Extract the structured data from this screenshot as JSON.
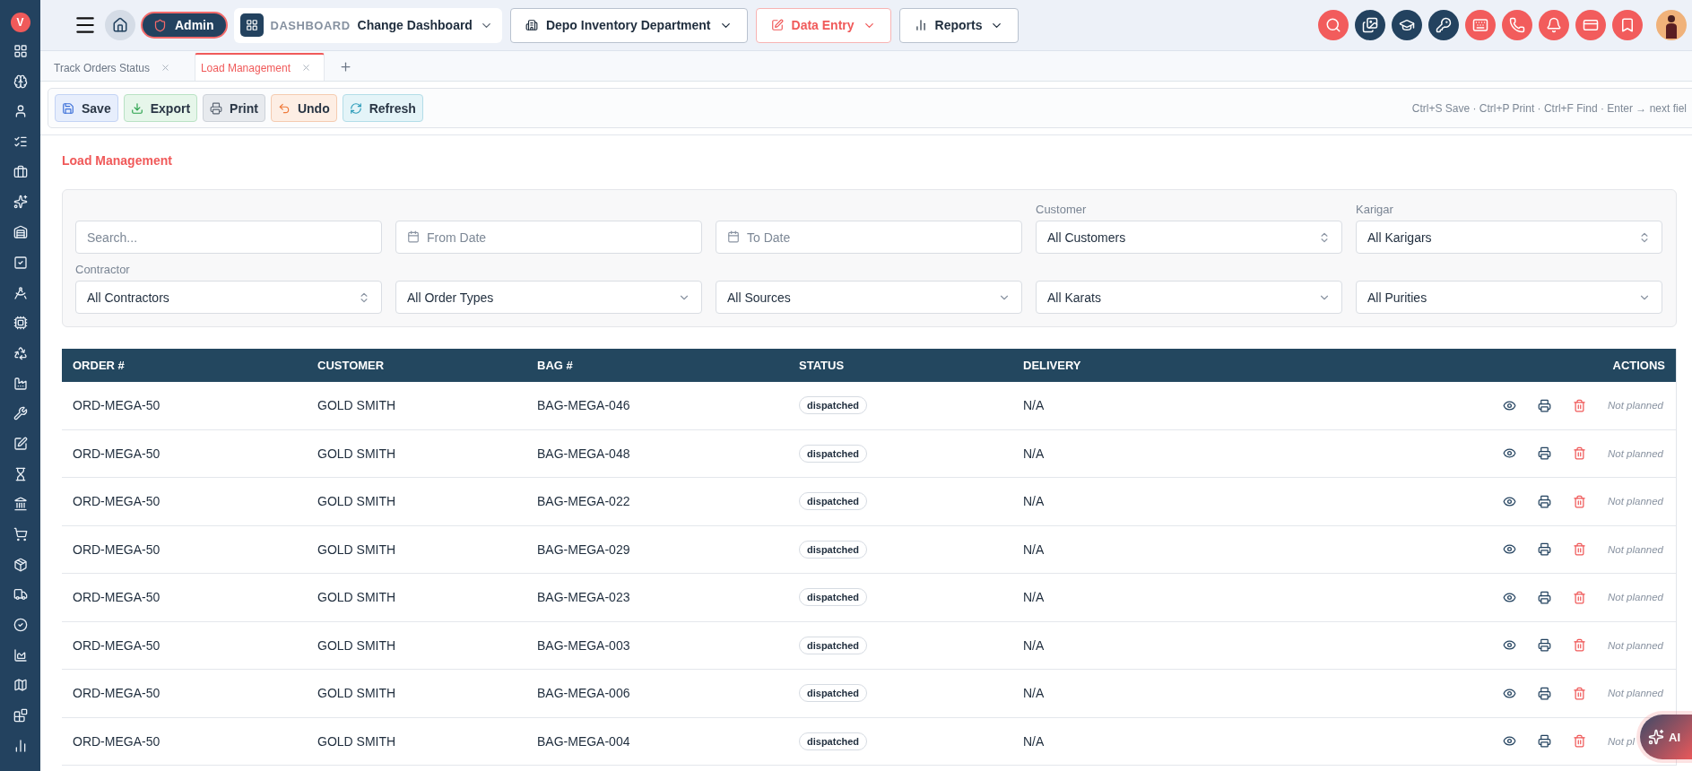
{
  "sidebar": {
    "logo": "V"
  },
  "topbar": {
    "role": "Admin",
    "dashboard": {
      "label": "DASHBOARD",
      "value": "Change Dashboard"
    },
    "menus": [
      {
        "label": "Depo Inventory Department",
        "active": false
      },
      {
        "label": "Data Entry",
        "active": true
      },
      {
        "label": "Reports",
        "active": false
      }
    ]
  },
  "tabs": [
    {
      "label": "Track Orders Status",
      "selected": false
    },
    {
      "label": "Load Management",
      "selected": true
    }
  ],
  "toolbar": {
    "buttons": [
      {
        "label": "Save",
        "kind": "save"
      },
      {
        "label": "Export",
        "kind": "export"
      },
      {
        "label": "Print",
        "kind": "print"
      },
      {
        "label": "Undo",
        "kind": "undo"
      },
      {
        "label": "Refresh",
        "kind": "refresh"
      }
    ],
    "hint": "Ctrl+S Save · Ctrl+P Print · Ctrl+F Find · Enter → next fiel"
  },
  "page_title": "Load Management",
  "filters": [
    {
      "kind": "search",
      "placeholder": "Search..."
    },
    {
      "kind": "date",
      "placeholder": "From Date"
    },
    {
      "kind": "date",
      "placeholder": "To Date"
    },
    {
      "kind": "combo",
      "label": "Customer",
      "value": "All Customers"
    },
    {
      "kind": "combo",
      "label": "Karigar",
      "value": "All Karigars"
    },
    {
      "kind": "combo",
      "label": "Contractor",
      "value": "All Contractors"
    },
    {
      "kind": "select",
      "value": "All Order Types"
    },
    {
      "kind": "select",
      "value": "All Sources"
    },
    {
      "kind": "select",
      "value": "All Karats"
    },
    {
      "kind": "select",
      "value": "All Purities"
    }
  ],
  "table": {
    "columns": [
      "ORDER #",
      "CUSTOMER",
      "BAG #",
      "STATUS",
      "DELIVERY",
      "ACTIONS"
    ],
    "rows": [
      {
        "order": "ORD-MEGA-50",
        "customer": "GOLD SMITH",
        "bag": "BAG-MEGA-046",
        "status": "dispatched",
        "delivery": "N/A",
        "note": "Not planned"
      },
      {
        "order": "ORD-MEGA-50",
        "customer": "GOLD SMITH",
        "bag": "BAG-MEGA-048",
        "status": "dispatched",
        "delivery": "N/A",
        "note": "Not planned"
      },
      {
        "order": "ORD-MEGA-50",
        "customer": "GOLD SMITH",
        "bag": "BAG-MEGA-022",
        "status": "dispatched",
        "delivery": "N/A",
        "note": "Not planned"
      },
      {
        "order": "ORD-MEGA-50",
        "customer": "GOLD SMITH",
        "bag": "BAG-MEGA-029",
        "status": "dispatched",
        "delivery": "N/A",
        "note": "Not planned"
      },
      {
        "order": "ORD-MEGA-50",
        "customer": "GOLD SMITH",
        "bag": "BAG-MEGA-023",
        "status": "dispatched",
        "delivery": "N/A",
        "note": "Not planned"
      },
      {
        "order": "ORD-MEGA-50",
        "customer": "GOLD SMITH",
        "bag": "BAG-MEGA-003",
        "status": "dispatched",
        "delivery": "N/A",
        "note": "Not planned"
      },
      {
        "order": "ORD-MEGA-50",
        "customer": "GOLD SMITH",
        "bag": "BAG-MEGA-006",
        "status": "dispatched",
        "delivery": "N/A",
        "note": "Not planned"
      },
      {
        "order": "ORD-MEGA-50",
        "customer": "GOLD SMITH",
        "bag": "BAG-MEGA-004",
        "status": "dispatched",
        "delivery": "N/A",
        "note": "Not pl"
      }
    ]
  },
  "ai_button": "AI"
}
